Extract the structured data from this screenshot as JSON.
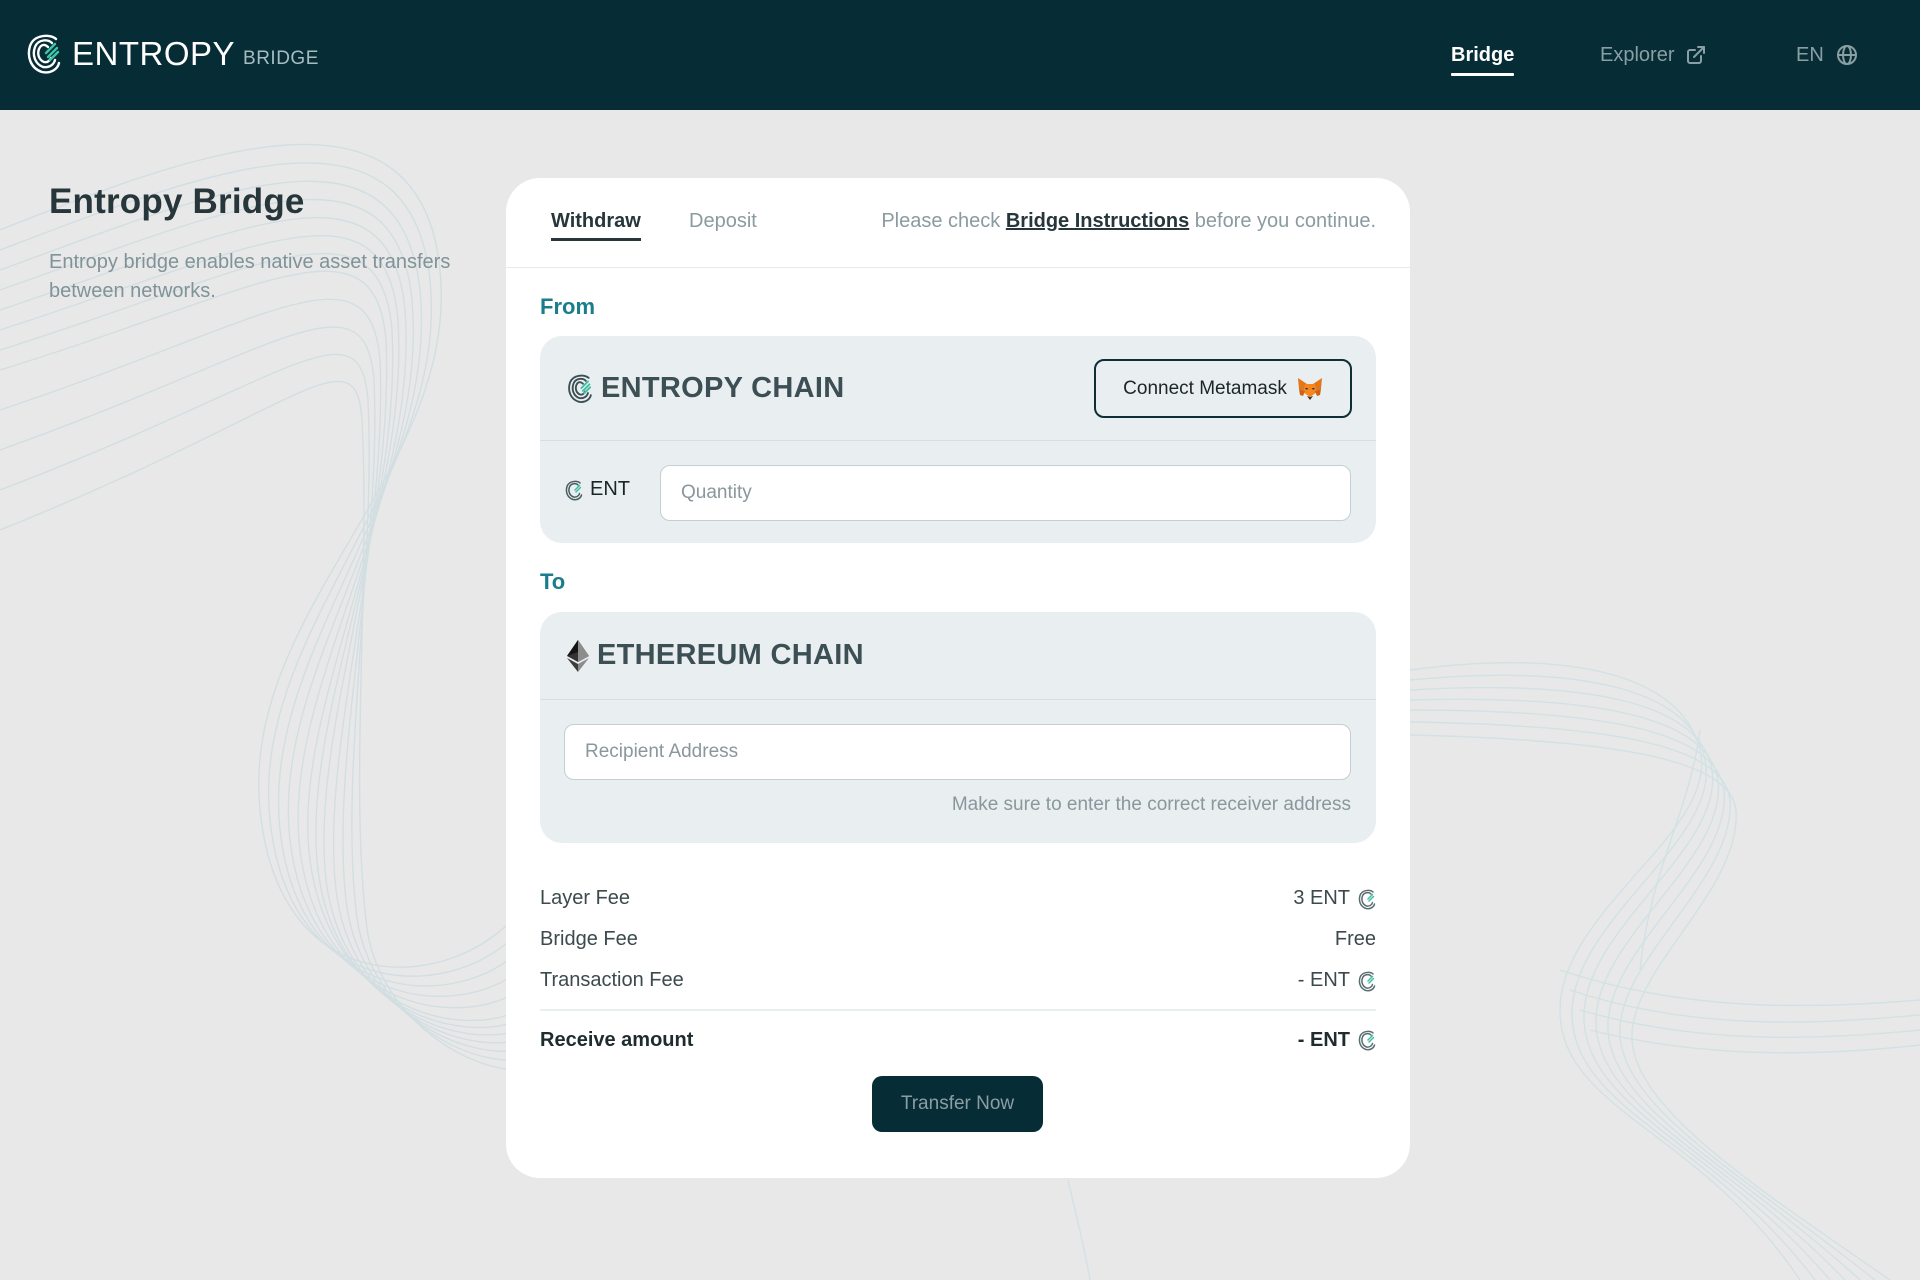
{
  "header": {
    "brand_name": "ENTROPY",
    "brand_sub": "BRIDGE",
    "logo_icon": "entropy-logo-icon",
    "nav": [
      {
        "label": "Bridge",
        "active": true
      },
      {
        "label": "Explorer",
        "icon": "external-link-icon"
      },
      {
        "label": "EN",
        "icon": "globe-icon"
      }
    ]
  },
  "intro": {
    "title": "Entropy Bridge",
    "description": "Entropy bridge enables native asset transfers between networks."
  },
  "card": {
    "tabs": [
      {
        "label": "Withdraw",
        "active": true
      },
      {
        "label": "Deposit",
        "active": false
      }
    ],
    "instructions": {
      "prefix": "Please check ",
      "link": "Bridge Instructions",
      "suffix": " before you continue."
    },
    "from": {
      "label": "From",
      "chain_name": "ENTROPY CHAIN",
      "chain_icon": "entropy-logo-icon",
      "connect_button": "Connect Metamask",
      "connect_icon": "metamask-fox-icon",
      "token": "ENT",
      "quantity_value": "",
      "quantity_placeholder": "Quantity"
    },
    "to": {
      "label": "To",
      "chain_name": "ETHEREUM CHAIN",
      "chain_icon": "ethereum-icon",
      "address_value": "",
      "address_placeholder": "Recipient Address",
      "hint": "Make sure to enter the correct receiver address"
    },
    "fees": [
      {
        "label": "Layer Fee",
        "value": "3 ENT",
        "icon": "entropy-logo-icon"
      },
      {
        "label": "Bridge Fee",
        "value": "Free"
      },
      {
        "label": "Transaction Fee",
        "value": "- ENT",
        "icon": "entropy-logo-icon"
      }
    ],
    "receive": {
      "label": "Receive amount",
      "value": "- ENT",
      "icon": "entropy-logo-icon"
    },
    "transfer_button": "Transfer Now"
  },
  "colors": {
    "header_bg": "#062c36",
    "page_bg": "#e8e8e8",
    "accent_teal": "#1a7d8c",
    "panel_bg": "#e9eef1",
    "button_bg": "#062c36"
  }
}
